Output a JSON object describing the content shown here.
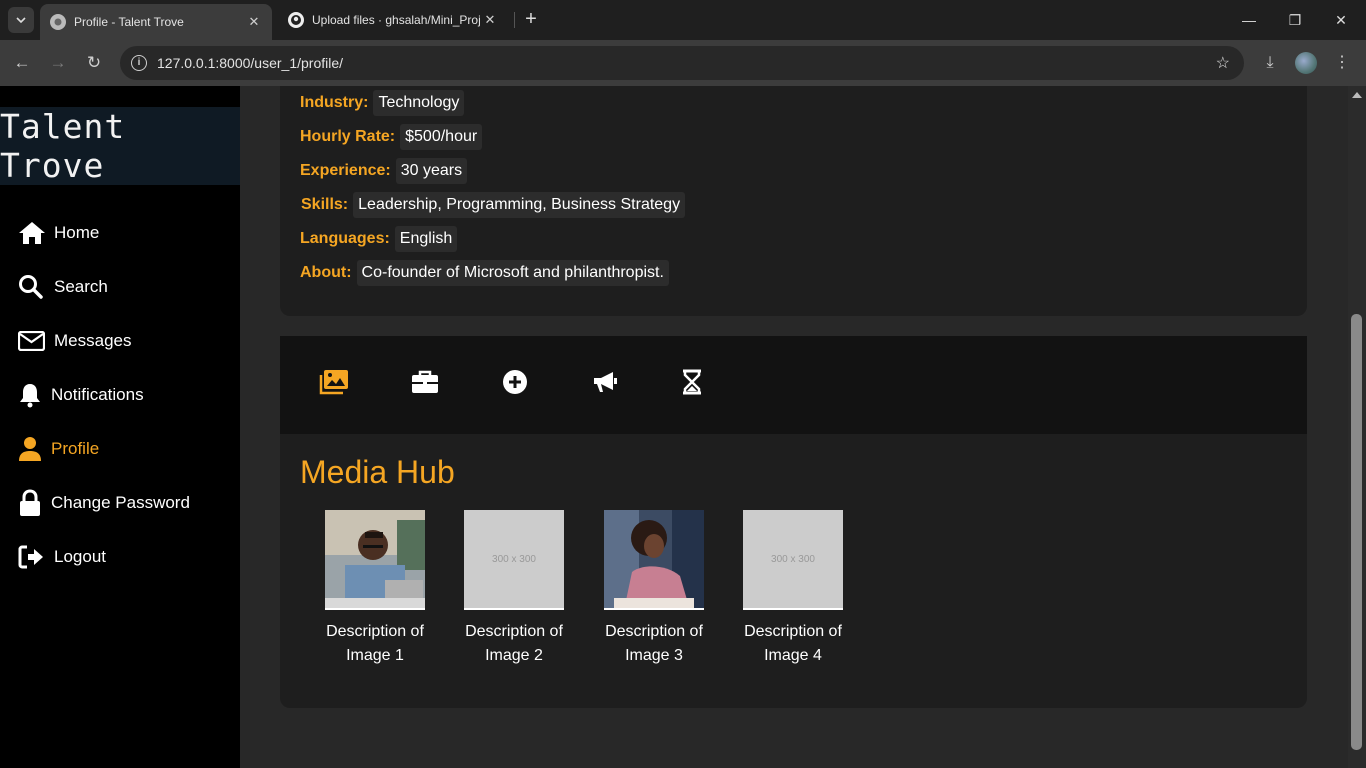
{
  "browser": {
    "tabs": [
      {
        "title": "Profile - Talent Trove",
        "active": true
      },
      {
        "title": "Upload files · ghsalah/Mini_Proj",
        "active": false
      }
    ],
    "url": "127.0.0.1:8000/user_1/profile/"
  },
  "sidebar": {
    "brand": "Talent Trove",
    "items": [
      {
        "label": "Home",
        "icon": "home-icon"
      },
      {
        "label": "Search",
        "icon": "search-icon"
      },
      {
        "label": "Messages",
        "icon": "envelope-icon"
      },
      {
        "label": "Notifications",
        "icon": "bell-icon"
      },
      {
        "label": "Profile",
        "icon": "user-icon",
        "active": true
      },
      {
        "label": "Change Password",
        "icon": "lock-icon"
      },
      {
        "label": "Logout",
        "icon": "logout-icon"
      }
    ]
  },
  "profile": {
    "fields": [
      {
        "label": "Industry:",
        "value": "Technology"
      },
      {
        "label": "Hourly Rate:",
        "value": "$500/hour"
      },
      {
        "label": "Experience:",
        "value": "30 years"
      },
      {
        "label": "Skills:",
        "value": "Leadership, Programming, Business Strategy"
      },
      {
        "label": "Languages:",
        "value": "English"
      },
      {
        "label": "About:",
        "value": "Co-founder of Microsoft and philanthropist."
      }
    ]
  },
  "iconbar": {
    "icons": [
      "images-icon",
      "briefcase-icon",
      "plus-circle-icon",
      "megaphone-icon",
      "hourglass-icon"
    ]
  },
  "media": {
    "title": "Media Hub",
    "items": [
      {
        "caption": "Description of Image 1",
        "placeholder": ""
      },
      {
        "caption": "Description of Image 2",
        "placeholder": "300 x 300"
      },
      {
        "caption": "Description of Image 3",
        "placeholder": ""
      },
      {
        "caption": "Description of Image 4",
        "placeholder": "300 x 300"
      }
    ]
  },
  "colors": {
    "accent": "#f5a623",
    "sidebar_bg": "#000000",
    "card_bg": "#1e1e1e"
  }
}
